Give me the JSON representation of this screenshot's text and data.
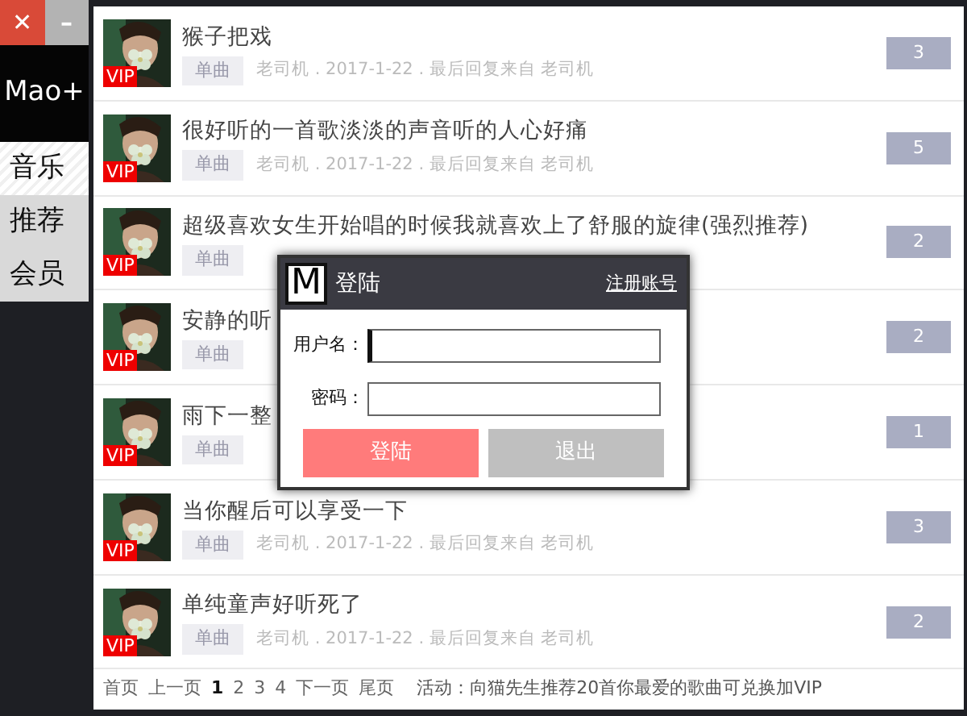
{
  "window_controls": [
    {
      "kind": "close",
      "label": "✕"
    },
    {
      "kind": "minimize",
      "label": "–"
    }
  ],
  "logo": {
    "text": "Mao+"
  },
  "sidebar": {
    "items": [
      {
        "label": "音乐",
        "selected": true
      },
      {
        "label": "推荐",
        "selected": false
      },
      {
        "label": "会员",
        "selected": false
      }
    ]
  },
  "posts": [
    {
      "title": "猴子把戏",
      "badge": "VIP",
      "tag": "单曲",
      "meta": "老司机 . 2017-1-22 . 最后回复来自 老司机",
      "count": "3"
    },
    {
      "title": "很好听的一首歌淡淡的声音听的人心好痛",
      "badge": "VIP",
      "tag": "单曲",
      "meta": "老司机 . 2017-1-22 . 最后回复来自 老司机",
      "count": "5"
    },
    {
      "title": "超级喜欢女生开始唱的时候我就喜欢上了舒服的旋律(强烈推荐)",
      "badge": "VIP",
      "tag": "单曲",
      "count": "2"
    },
    {
      "title": "安静的听",
      "badge": "VIP",
      "tag": "单曲",
      "count": "2"
    },
    {
      "title": "雨下一整",
      "badge": "VIP",
      "tag": "单曲",
      "count": "1"
    },
    {
      "title": "当你醒后可以享受一下",
      "badge": "VIP",
      "tag": "单曲",
      "meta": "老司机 . 2017-1-22 . 最后回复来自 老司机",
      "count": "3"
    },
    {
      "title": "单纯童声好听死了",
      "badge": "VIP",
      "tag": "单曲",
      "meta": "老司机 . 2017-1-22 . 最后回复来自 老司机",
      "count": "2"
    }
  ],
  "pagination": [
    {
      "label": "首页",
      "selected": false
    },
    {
      "label": "上一页",
      "selected": false
    },
    {
      "label": "1",
      "selected": true
    },
    {
      "label": "2",
      "selected": false
    },
    {
      "label": "3",
      "selected": false
    },
    {
      "label": "4",
      "selected": false
    },
    {
      "label": "下一页",
      "selected": false
    },
    {
      "label": "尾页",
      "selected": false
    }
  ],
  "notice": "活动：向猫先生推荐20首你最爱的歌曲可兑换加VIP",
  "login_dialog": {
    "logo": "M",
    "title": "登陆",
    "register_link": "注册账号",
    "fields": [
      {
        "label": "用户名：",
        "focused": true
      },
      {
        "label": "密码：",
        "focused": false
      }
    ],
    "buttons": [
      {
        "label": "登陆",
        "kind": "primary"
      },
      {
        "label": "退出",
        "kind": "secondary"
      }
    ]
  }
}
